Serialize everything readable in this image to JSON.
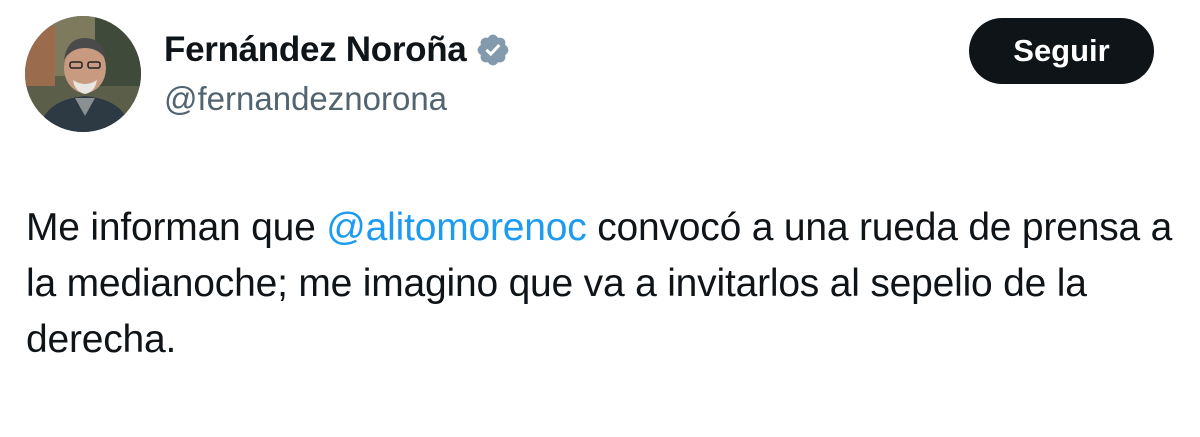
{
  "author": {
    "display_name": "Fernández Noroña",
    "handle": "@fernandeznorona",
    "verified_icon": "verified-badge-icon",
    "verified_color": "#829aab",
    "avatar": "profile-photo"
  },
  "follow_button": {
    "label": "Seguir",
    "background": "#0f1419",
    "text_color": "#ffffff"
  },
  "tweet": {
    "text_before": "Me informan que ",
    "mention": "@alitomorenoc",
    "text_after": " convocó a una rueda de prensa a la medianoche; me imagino que va a invitarlos al sepelio de la derecha.",
    "mention_color": "#1d9bf0"
  }
}
